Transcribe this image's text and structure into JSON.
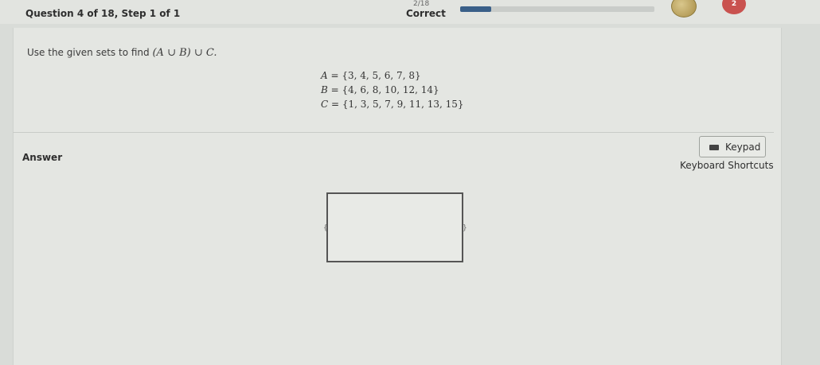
{
  "header": {
    "question_label": "Question 4 of 18, Step 1 of 1",
    "progress_count": "2/18",
    "status": "Correct",
    "progress_fraction": 0.16,
    "coin_icon": "coin-icon",
    "badge_value": "2",
    "badge_icon": "heart-icon"
  },
  "question": {
    "prompt": "Use the given sets to find",
    "expression": "(A ∪ B) ∪ C.",
    "sets": [
      {
        "name": "A",
        "members": "= {3, 4, 5, 6, 7, 8}"
      },
      {
        "name": "B",
        "members": "= {4, 6, 8, 10, 12, 14}"
      },
      {
        "name": "C",
        "members": "= {1, 3, 5, 7, 9, 11, 13, 15}"
      }
    ]
  },
  "answer": {
    "label": "Answer",
    "keypad_label": "Keypad",
    "keypad_icon": "keyboard-icon",
    "shortcuts_label": "Keyboard Shortcuts",
    "open_brace": "{",
    "close_brace": "}",
    "value": ""
  },
  "colors": {
    "progress_fill": "#3a5f88",
    "badge": "#c9524f"
  }
}
